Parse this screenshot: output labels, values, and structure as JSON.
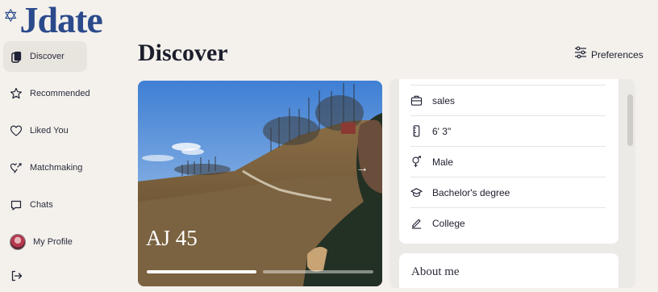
{
  "brand": {
    "logo_text": "Jdate",
    "star_icon": "star-of-david-icon",
    "color": "#2b4a8c"
  },
  "sidebar": {
    "items": [
      {
        "label": "Discover",
        "icon": "phone-cards-icon",
        "active": true
      },
      {
        "label": "Recommended",
        "icon": "star-icon"
      },
      {
        "label": "Liked You",
        "icon": "heart-icon"
      },
      {
        "label": "Matchmaking",
        "icon": "matchmaking-heart-icon"
      },
      {
        "label": "Chats",
        "icon": "chat-bubble-icon"
      },
      {
        "label": "My Profile",
        "icon": "avatar"
      }
    ],
    "logout_icon": "logout-icon"
  },
  "header": {
    "title": "Discover",
    "preferences_label": "Preferences"
  },
  "profile": {
    "name_age": "AJ 45",
    "photo_count": 2,
    "current_photo": 1,
    "details": [
      {
        "icon": "briefcase-icon",
        "value": "sales"
      },
      {
        "icon": "ruler-icon",
        "value": "6' 3\""
      },
      {
        "icon": "gender-male-icon",
        "value": "Male"
      },
      {
        "icon": "graduation-cap-icon",
        "value": "Bachelor's degree"
      },
      {
        "icon": "pencil-icon",
        "value": "College"
      }
    ],
    "about_title": "About me"
  }
}
